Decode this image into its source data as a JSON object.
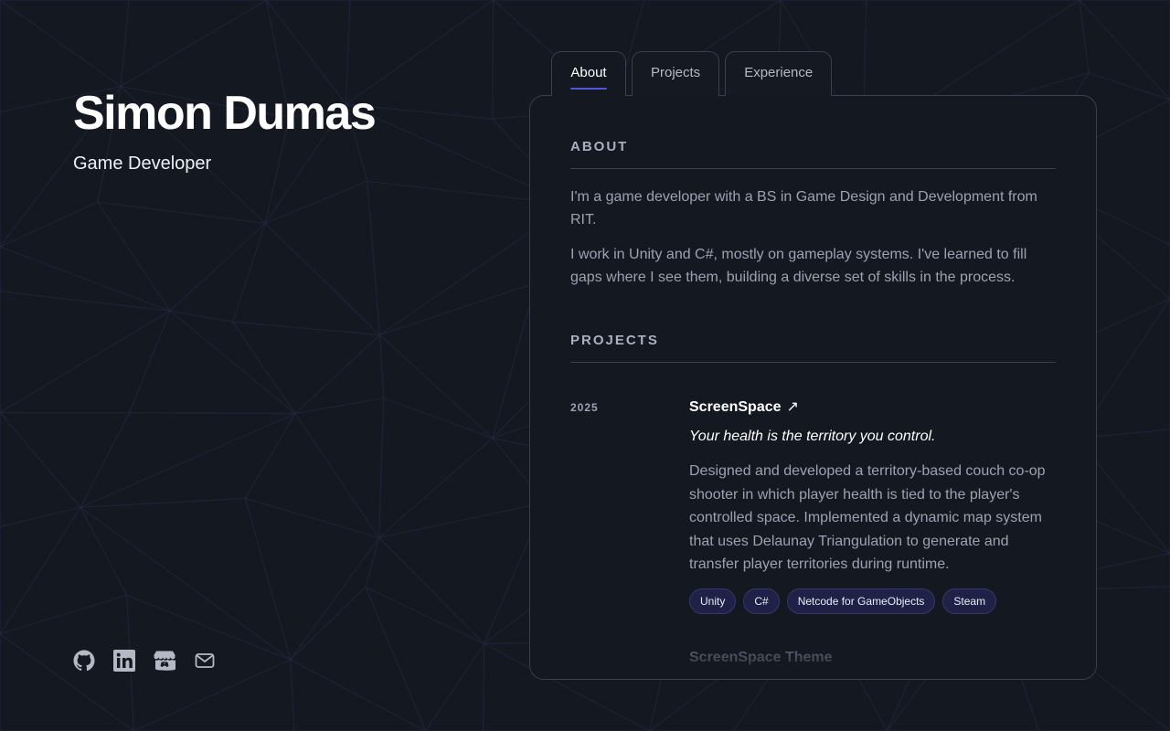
{
  "hero": {
    "name": "Simon Dumas",
    "role": "Game Developer"
  },
  "socials": [
    {
      "icon": "github-icon"
    },
    {
      "icon": "linkedin-icon"
    },
    {
      "icon": "itchio-icon"
    },
    {
      "icon": "mail-icon"
    }
  ],
  "tabs": [
    {
      "label": "About",
      "active": true
    },
    {
      "label": "Projects",
      "active": false
    },
    {
      "label": "Experience",
      "active": false
    }
  ],
  "about": {
    "heading": "ABOUT",
    "paragraphs": [
      "I'm a game developer with a BS in Game Design and Development from RIT.",
      "I work in Unity and C#, mostly on gameplay systems. I've learned to fill gaps where I see them, building a diverse set of skills in the process."
    ]
  },
  "projects": {
    "heading": "PROJECTS",
    "items": [
      {
        "year": "2025",
        "title": "ScreenSpace",
        "arrow": "↗",
        "tagline": "Your health is the territory you control.",
        "description": "Designed and developed a territory-based couch co-op shooter in which player health is tied to the player's controlled space. Implemented a dynamic map system that uses Delaunay Triangulation to generate and transfer player territories during runtime.",
        "tags": [
          "Unity",
          "C#",
          "Netcode for GameObjects",
          "Steam"
        ]
      }
    ],
    "next_title": "ScreenSpace Theme"
  },
  "colors": {
    "background": "#141820",
    "accent": "#5157d8",
    "tag_background": "#1f2246",
    "muted_text": "#9ba2b2"
  }
}
